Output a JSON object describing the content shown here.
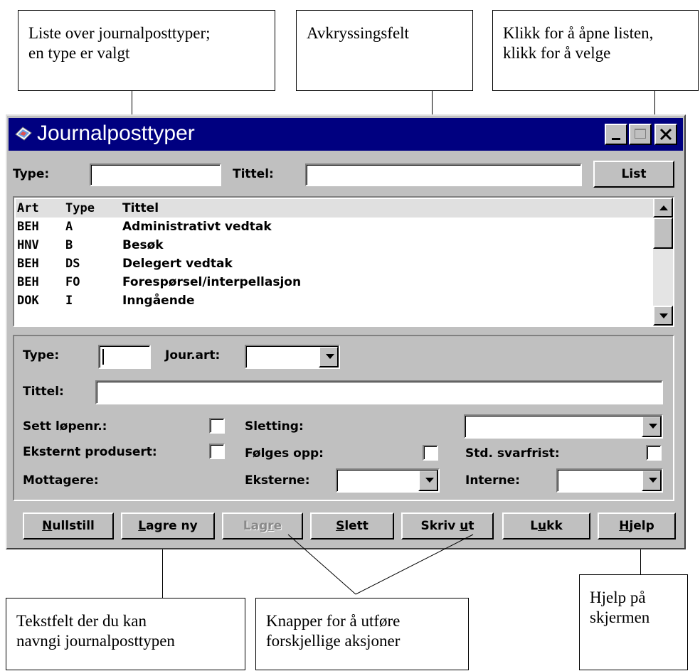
{
  "callouts": {
    "list_types": "Liste over journalposttyper;\nen type er valgt",
    "checkbox": "Avkryssingsfelt",
    "dropdown": "Klikk for å åpne listen,\nklikk for å velge",
    "textfield": "Tekstfelt der du kan\nnavngi journalposttypen",
    "buttons": "Knapper for å utføre\nforskjellige aksjoner",
    "help": "Hjelp på\nskjermen"
  },
  "window": {
    "title": "Journalposttyper",
    "icon": "journal-app-icon"
  },
  "search": {
    "type_label": "Type:",
    "type_value": "",
    "title_label": "Tittel:",
    "title_value": "",
    "list_button": "List"
  },
  "list": {
    "headers": [
      "Art",
      "Type",
      "Tittel"
    ],
    "rows": [
      {
        "art": "BEH",
        "type": "A",
        "tittel": "Administrativt vedtak"
      },
      {
        "art": "HNV",
        "type": "B",
        "tittel": "Besøk"
      },
      {
        "art": "BEH",
        "type": "DS",
        "tittel": "Delegert vedtak"
      },
      {
        "art": "BEH",
        "type": "FO",
        "tittel": "Forespørsel/interpellasjon"
      },
      {
        "art": "DOK",
        "type": "I",
        "tittel": "Inngående"
      }
    ]
  },
  "form": {
    "type_label": "Type:",
    "type_value": "",
    "jourart_label": "Jour.art:",
    "jourart_value": "",
    "tittel_label": "Tittel:",
    "tittel_value": "",
    "sett_lopenr_label": "Sett løpenr.:",
    "sletting_label": "Sletting:",
    "sletting_value": "",
    "eksternt_label": "Eksternt produsert:",
    "folges_label": "Følges opp:",
    "svarfrist_label": "Std. svarfrist:",
    "mottagere_label": "Mottagere:",
    "eksterne_label": "Eksterne:",
    "eksterne_value": "",
    "interne_label": "Interne:",
    "interne_value": ""
  },
  "buttons": {
    "nullstill": {
      "pre": "",
      "u": "N",
      "post": "ullstill"
    },
    "lagre_ny": {
      "pre": "",
      "u": "L",
      "post": "agre ny"
    },
    "lagre": {
      "pre": "Lag",
      "u": "r",
      "post": "e"
    },
    "slett": {
      "pre": "",
      "u": "S",
      "post": "lett"
    },
    "skriv_ut": {
      "pre": "Skriv ",
      "u": "u",
      "post": "t"
    },
    "lukk": {
      "pre": "L",
      "u": "u",
      "post": "kk"
    },
    "hjelp": {
      "pre": "",
      "u": "H",
      "post": "jelp"
    }
  }
}
